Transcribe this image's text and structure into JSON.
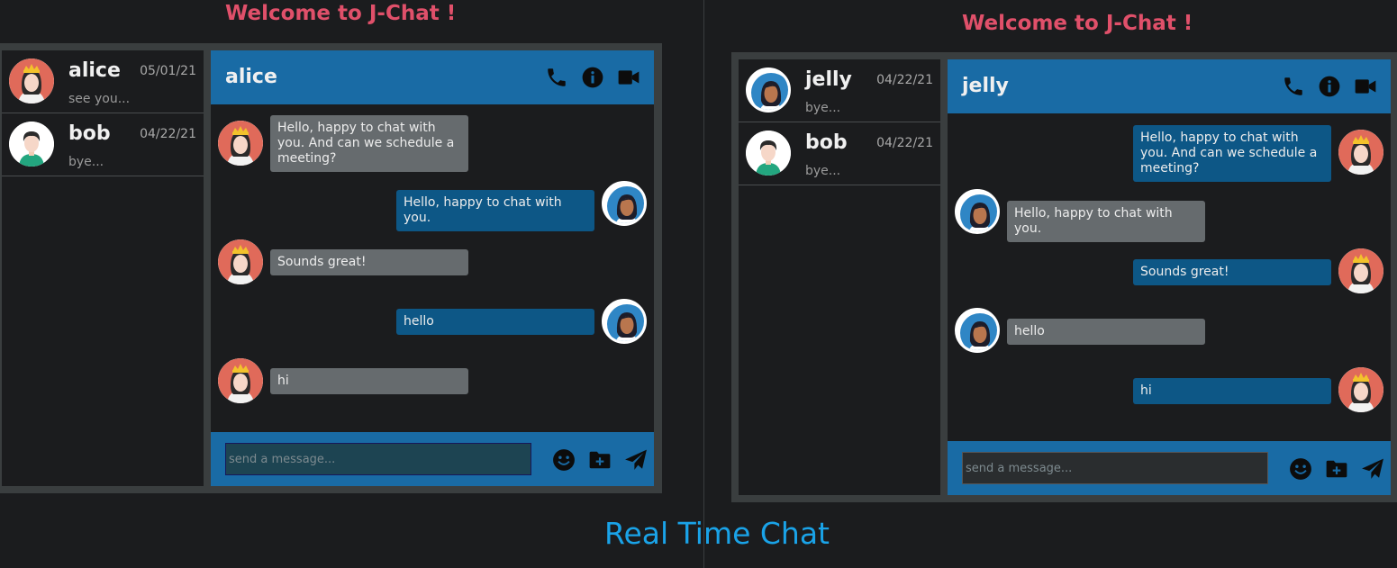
{
  "footer_title": "Real Time Chat",
  "panels": [
    {
      "welcome": "Welcome to J-Chat !",
      "contacts": [
        {
          "name": "alice",
          "date": "05/01/21",
          "preview": "see you...",
          "avatar": "woman-crown"
        },
        {
          "name": "bob",
          "date": "04/22/21",
          "preview": "bye...",
          "avatar": "man"
        }
      ],
      "chat_title": "alice",
      "messages": [
        {
          "text": "Hello, happy to chat with you. And can we schedule a meeting?",
          "side": "left",
          "avatar": "woman-crown"
        },
        {
          "text": "Hello, happy to chat with you.",
          "side": "right",
          "avatar": "woman-dark"
        },
        {
          "text": "Sounds great!",
          "side": "left",
          "avatar": "woman-crown"
        },
        {
          "text": "hello",
          "side": "right",
          "avatar": "woman-dark"
        },
        {
          "text": "hi",
          "side": "left",
          "avatar": "woman-crown"
        }
      ],
      "input_placeholder": "send a message..."
    },
    {
      "welcome": "Welcome to J-Chat !",
      "contacts": [
        {
          "name": "jelly",
          "date": "04/22/21",
          "preview": "bye...",
          "avatar": "woman-dark"
        },
        {
          "name": "bob",
          "date": "04/22/21",
          "preview": "bye...",
          "avatar": "man"
        }
      ],
      "chat_title": "jelly",
      "messages": [
        {
          "text": "Hello, happy to chat with you. And can we schedule a meeting?",
          "side": "right",
          "avatar": "woman-crown"
        },
        {
          "text": "Hello, happy to chat with you.",
          "side": "left",
          "avatar": "woman-dark"
        },
        {
          "text": "Sounds great!",
          "side": "right",
          "avatar": "woman-crown"
        },
        {
          "text": "hello",
          "side": "left",
          "avatar": "woman-dark"
        },
        {
          "text": "hi",
          "side": "right",
          "avatar": "woman-crown"
        }
      ],
      "input_placeholder": "send a message..."
    }
  ],
  "colors": {
    "accent_blue": "#196ba5",
    "bubble_blue": "#0d5786",
    "bubble_gray": "#666b6e",
    "welcome_red": "#e0506a",
    "footer_blue": "#1aa3e8"
  }
}
